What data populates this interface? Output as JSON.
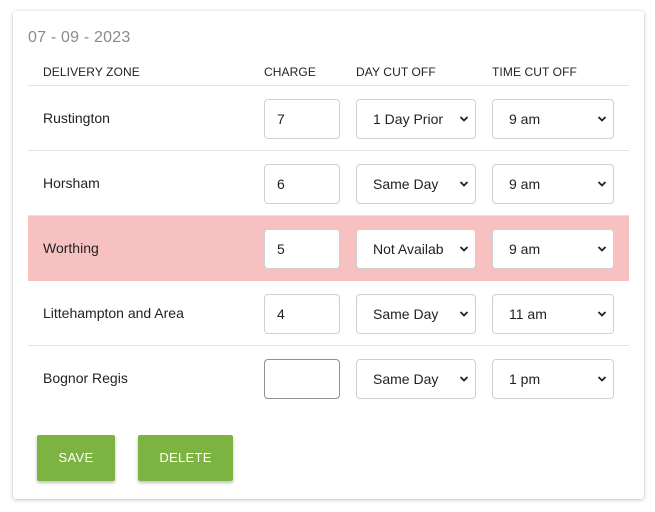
{
  "date": "07 - 09 - 2023",
  "columns": {
    "zone": "DELIVERY ZONE",
    "charge": "CHARGE",
    "day": "DAY CUT OFF",
    "time": "TIME CUT OFF"
  },
  "rows": [
    {
      "zone": "Rustington",
      "charge": "7",
      "day": "1 Day Prior",
      "time": "9 am",
      "highlighted": false
    },
    {
      "zone": "Horsham",
      "charge": "6",
      "day": "Same Day",
      "time": "9 am",
      "highlighted": false
    },
    {
      "zone": "Worthing",
      "charge": "5",
      "day": "Not Availab",
      "time": "9 am",
      "highlighted": true
    },
    {
      "zone": "Littehampton and Area",
      "charge": "4",
      "day": "Same Day",
      "time": "11 am",
      "highlighted": false
    },
    {
      "zone": "Bognor Regis",
      "charge": "",
      "day": "Same Day",
      "time": "1 pm",
      "highlighted": false
    }
  ],
  "buttons": {
    "save": "SAVE",
    "delete": "DELETE"
  },
  "colors": {
    "accent": "#7cb342",
    "highlight_row": "#f8c1c1"
  },
  "icons": {
    "select_arrow": "chevron-down-icon"
  }
}
